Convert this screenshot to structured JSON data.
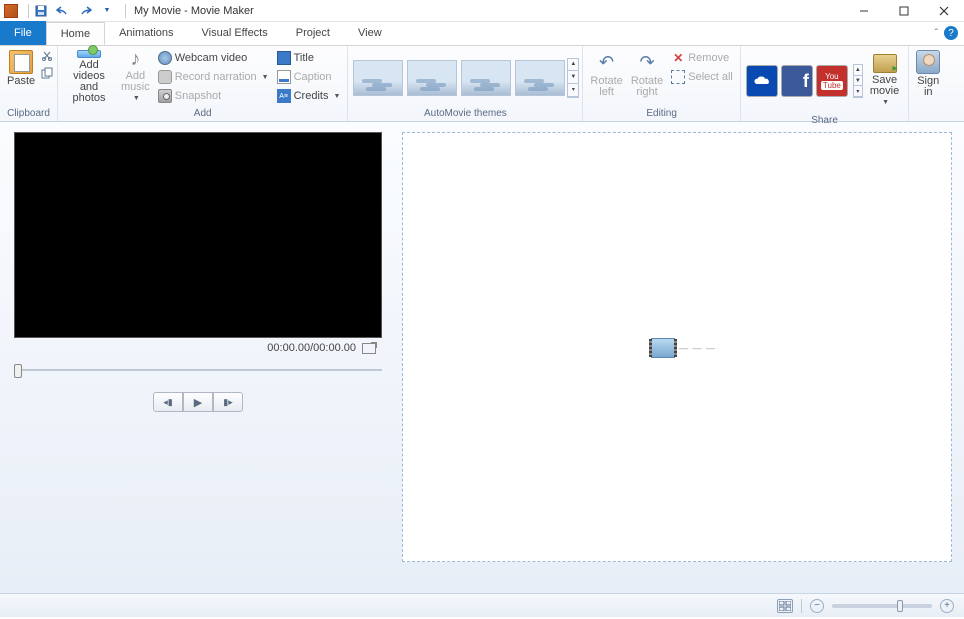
{
  "titlebar": {
    "title": "My Movie - Movie Maker"
  },
  "tabs": {
    "file": "File",
    "items": [
      "Home",
      "Animations",
      "Visual Effects",
      "Project",
      "View"
    ],
    "active_index": 0
  },
  "ribbon": {
    "clipboard": {
      "label": "Clipboard",
      "paste": "Paste"
    },
    "add": {
      "label": "Add",
      "add_vp": "Add videos\nand photos",
      "add_music": "Add\nmusic",
      "webcam": "Webcam video",
      "record": "Record narration",
      "snapshot": "Snapshot",
      "title": "Title",
      "caption": "Caption",
      "credits": "Credits"
    },
    "automovie": {
      "label": "AutoMovie themes"
    },
    "editing": {
      "label": "Editing",
      "rotate_left": "Rotate\nleft",
      "rotate_right": "Rotate\nright",
      "remove": "Remove",
      "select_all": "Select all"
    },
    "share": {
      "label": "Share",
      "save_movie": "Save\nmovie",
      "yt_top": "You",
      "yt_bot": "Tube"
    },
    "signin": {
      "label": "Sign\nin"
    }
  },
  "preview": {
    "time": "00:00.00/00:00.00"
  }
}
